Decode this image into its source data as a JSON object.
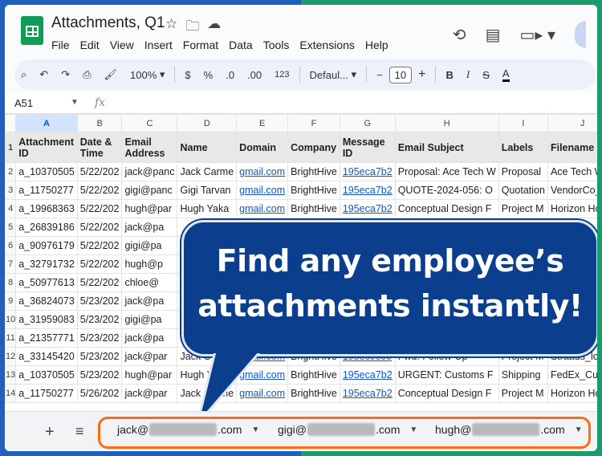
{
  "document": {
    "title": "Attachments, Q1",
    "menu": [
      "File",
      "Edit",
      "View",
      "Insert",
      "Format",
      "Data",
      "Tools",
      "Extensions",
      "Help"
    ]
  },
  "toolbar": {
    "zoom": "100%",
    "currency": "$",
    "percent": "%",
    "decrease_decimal": ".0",
    "increase_decimal": ".00",
    "number_format": "123",
    "font": "Defaul...",
    "minus": "−",
    "font_size": "10",
    "plus": "+",
    "bold": "B",
    "italic": "I",
    "strike": "S",
    "text_color": "A"
  },
  "formula_bar": {
    "cell_ref": "A51",
    "fx": "fx"
  },
  "columns": [
    "A",
    "B",
    "C",
    "D",
    "E",
    "F",
    "G",
    "H",
    "I",
    "J"
  ],
  "header_row": [
    "Attachment ID",
    "Date & Time",
    "Email Address",
    "Name",
    "Domain",
    "Company",
    "Message ID",
    "Email Subject",
    "Labels",
    "Filename"
  ],
  "rows": [
    [
      "2",
      "a_10370505",
      "5/22/202",
      "jack@panc",
      "Jack Carme",
      "gmail.com",
      "BrightHive",
      "195eca7b2",
      "Proposal: Ace Tech W",
      "Proposal",
      "Ace Tech We"
    ],
    [
      "3",
      "a_11750277",
      "5/22/202",
      "gigi@panc",
      "Gigi Tarvan",
      "gmail.com",
      "BrightHive",
      "195eca7b2",
      "QUOTE-2024-056: O",
      "Quotation",
      "VendorCo_Qu"
    ],
    [
      "4",
      "a_19968363",
      "5/22/202",
      "hugh@par",
      "Hugh Yaka",
      "gmail.com",
      "BrightHive",
      "195eca7b2",
      "Conceptual Design F",
      "Project M",
      "Horizon Hote"
    ],
    [
      "5",
      "a_26839186",
      "5/22/202",
      "jack@pa",
      "",
      "",
      "",
      "",
      "",
      "",
      ""
    ],
    [
      "6",
      "a_90976179",
      "5/22/202",
      "gigi@pa",
      "",
      "",
      "",
      "",
      "",
      "",
      ""
    ],
    [
      "7",
      "a_32791732",
      "5/22/202",
      "hugh@p",
      "",
      "",
      "",
      "",
      "",
      "",
      ""
    ],
    [
      "8",
      "a_50977613",
      "5/22/202",
      "chloe@",
      "",
      "",
      "",
      "",
      "",
      "",
      ""
    ],
    [
      "9",
      "a_36824073",
      "5/23/202",
      "jack@pa",
      "",
      "",
      "",
      "",
      "",
      "",
      ""
    ],
    [
      "10",
      "a_31959083",
      "5/23/202",
      "gigi@pa",
      "",
      "",
      "",
      "",
      "",
      "",
      ""
    ],
    [
      "11",
      "a_21357771",
      "5/23/202",
      "jack@pa",
      "",
      "",
      "",
      "",
      "",
      "",
      ""
    ],
    [
      "12",
      "a_33145420",
      "5/23/202",
      "jack@par",
      "Jack C",
      "gmail.com",
      "BrightHive",
      "195ec9c00",
      "Fwd: Follow-Up",
      "Project M",
      "Strattus_logo"
    ],
    [
      "13",
      "a_10370505",
      "5/23/202",
      "hugh@par",
      "Hugh Yaka",
      "gmail.com",
      "BrightHive",
      "195eca7b2",
      "URGENT: Customs F",
      "Shipping",
      "FedEx_Custo"
    ],
    [
      "14",
      "a_11750277",
      "5/26/202",
      "jack@par",
      "Jack Carme",
      "gmail.com",
      "BrightHive",
      "195eca7b2",
      "Conceptual Design F",
      "Project M",
      "Horizon Hote"
    ]
  ],
  "sheet_tabs": [
    {
      "prefix": "jack@",
      "suffix": ".com"
    },
    {
      "prefix": "gigi@",
      "suffix": ".com"
    },
    {
      "prefix": "hugh@",
      "suffix": ".com"
    }
  ],
  "callout": {
    "line1": "Find any employee’s",
    "line2": "attachments instantly!"
  },
  "colors": {
    "callout_bg": "#0b3f8e",
    "highlight_outline": "#ff6a13",
    "sheets_green": "#0f9d58",
    "link_blue": "#1155cc"
  }
}
